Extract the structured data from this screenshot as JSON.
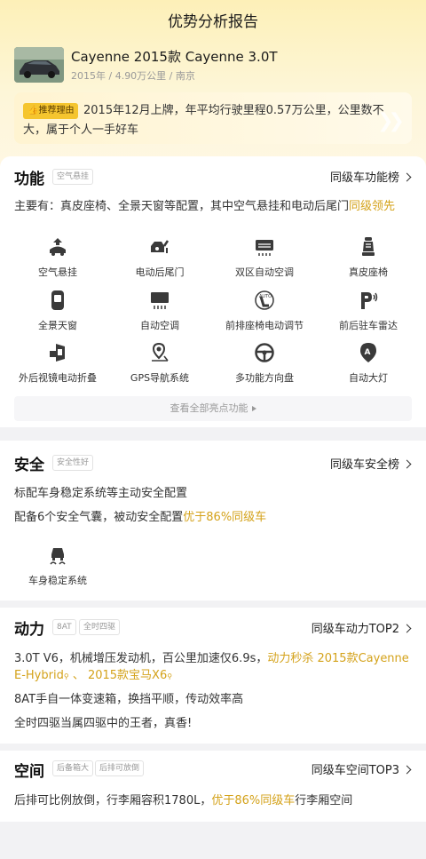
{
  "header": {
    "title": "优势分析报告"
  },
  "car": {
    "name": "Cayenne 2015款 Cayenne 3.0T",
    "meta": "2015年 / 4.90万公里 / 南京"
  },
  "reason": {
    "tag": "推荐理由",
    "text": "2015年12月上牌，年平均行驶里程0.57万公里，公里数不大，属于个人一手好车"
  },
  "function": {
    "title": "功能",
    "tag": "空气悬挂",
    "rank": "同级车功能榜",
    "desc_prefix": "主要有：真皮座椅、全景天窗等配置，其中空气悬挂和电动后尾门",
    "desc_highlight": "同级领先",
    "features": [
      {
        "label": "空气悬挂",
        "icon": "air-suspension-icon"
      },
      {
        "label": "电动后尾门",
        "icon": "power-tailgate-icon"
      },
      {
        "label": "双区自动空调",
        "icon": "dual-zone-ac-icon"
      },
      {
        "label": "真皮座椅",
        "icon": "leather-seat-icon"
      },
      {
        "label": "全景天窗",
        "icon": "panoramic-sunroof-icon"
      },
      {
        "label": "自动空调",
        "icon": "auto-ac-icon"
      },
      {
        "label": "前排座椅电动调节",
        "icon": "power-seat-adjust-icon"
      },
      {
        "label": "前后驻车雷达",
        "icon": "parking-radar-icon"
      },
      {
        "label": "外后视镜电动折叠",
        "icon": "mirror-fold-icon"
      },
      {
        "label": "GPS导航系统",
        "icon": "gps-navigation-icon"
      },
      {
        "label": "多功能方向盘",
        "icon": "steering-wheel-icon"
      },
      {
        "label": "自动大灯",
        "icon": "auto-headlight-icon"
      }
    ],
    "more": "查看全部亮点功能"
  },
  "safety": {
    "title": "安全",
    "tag": "安全性好",
    "rank": "同级车安全榜",
    "line1": "标配车身稳定系统等主动安全配置",
    "line2_prefix": "配备6个安全气囊，被动安全配置",
    "line2_highlight": "优于86%同级车",
    "feature_label": "车身稳定系统"
  },
  "power": {
    "title": "动力",
    "tags": [
      "8AT",
      "全时四驱"
    ],
    "rank": "同级车动力TOP2",
    "line1_prefix": "3.0T V6，机械增压发动机，百公里加速仅6.9s，",
    "line1_highlight": "动力秒杀 2015款Cayenne",
    "line2_part1": "E-Hybrid",
    "line2_sep": " 、 ",
    "line2_part2": "2015款宝马X6",
    "line3": "8AT手自一体变速箱，换挡平顺，传动效率高",
    "line4": "全时四驱当属四驱中的王者，真香!"
  },
  "space": {
    "title": "空间",
    "tags": [
      "后备箱大",
      "后排可放倒"
    ],
    "rank": "同级车空间TOP3",
    "line_prefix": "后排可比例放倒，行李厢容积1780L，",
    "line_highlight": "优于86%同级车",
    "line_suffix": "行李厢空间"
  },
  "colors": {
    "accent": "#d4a21a",
    "tag_bg": "#f5c52f",
    "hero_bg": "#fdf0b8"
  }
}
